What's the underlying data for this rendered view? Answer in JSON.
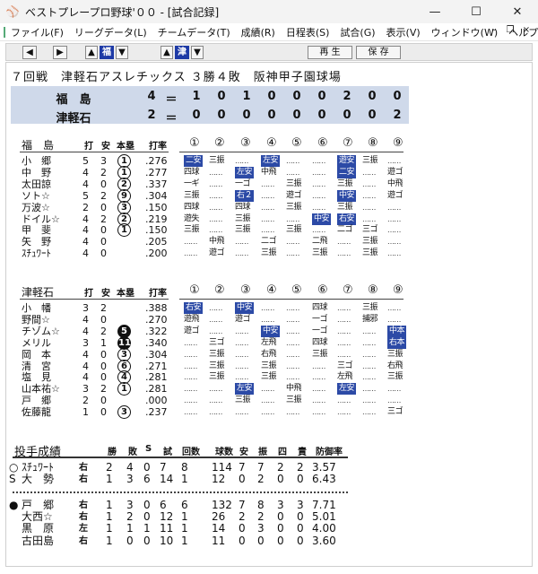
{
  "window": {
    "title": "ベストプレープロ野球'００ - [試合記録]",
    "min": "—",
    "max": "☐",
    "close": "✕"
  },
  "menu": [
    "ファイル(F)",
    "リーグデータ(L)",
    "チームデータ(T)",
    "成績(R)",
    "日程表(S)",
    "試合(G)",
    "表示(V)",
    "ウィンドウ(W)",
    "ヘルプ(H)"
  ],
  "mdi": {
    "min": "–",
    "restore": "❐",
    "close": "×"
  },
  "toolbar": {
    "prev": "◀",
    "next": "▶",
    "team1": "福",
    "team2": "津",
    "play": "再 生",
    "save": "保 存"
  },
  "game": {
    "info": "７回戦　津軽石アスレチックス ３勝４敗　阪神甲子園球場"
  },
  "score": {
    "rows": [
      {
        "team": "福　島",
        "total": "4",
        "innings": [
          "1",
          "0",
          "1",
          "0",
          "0",
          "0",
          "2",
          "0",
          "0"
        ]
      },
      {
        "team": "津軽石",
        "total": "2",
        "innings": [
          "0",
          "0",
          "0",
          "0",
          "0",
          "0",
          "0",
          "0",
          "2"
        ]
      }
    ]
  },
  "headers": {
    "ab": "打",
    "h": "安",
    "hr": "本塁",
    "avg": "打率",
    "inn": [
      "①",
      "②",
      "③",
      "④",
      "⑤",
      "⑥",
      "⑦",
      "⑧",
      "⑨"
    ]
  },
  "teamA": {
    "name": "福　島",
    "batters": [
      {
        "name": "小　郷",
        "ab": "5",
        "h": "3",
        "hr": "1",
        "avg": ".276",
        "r": [
          [
            "二安",
            1
          ],
          [
            "三振",
            0
          ],
          "",
          [
            "左安",
            1
          ],
          "",
          [
            "",
            0
          ],
          [
            "遊安",
            1
          ],
          [
            "三振",
            0
          ],
          ""
        ]
      },
      {
        "name": "中　野",
        "ab": "4",
        "h": "2",
        "hr": "1",
        "avg": ".277",
        "r": [
          [
            "四球",
            0
          ],
          "",
          [
            "左安",
            1
          ],
          [
            "中飛",
            0
          ],
          "",
          "",
          [
            "二安",
            1
          ],
          "",
          [
            "遊ゴ",
            0
          ]
        ]
      },
      {
        "name": "太田諒",
        "ab": "4",
        "h": "0",
        "hr": "2",
        "avg": ".337",
        "r": [
          [
            "一ギ",
            0
          ],
          "",
          [
            "一ゴ",
            0
          ],
          "",
          [
            "三振",
            0
          ],
          "",
          [
            "三振",
            0
          ],
          "",
          [
            "中飛",
            0
          ]
        ]
      },
      {
        "name": "ソト☆",
        "ab": "5",
        "h": "2",
        "hr": "9",
        "avg": ".304",
        "r": [
          [
            "三振",
            0
          ],
          "",
          [
            "右２",
            1
          ],
          "",
          [
            "遊ゴ",
            0
          ],
          "",
          [
            "中安",
            1
          ],
          "",
          [
            "遊ゴ",
            0
          ]
        ]
      },
      {
        "name": "万波☆",
        "ab": "2",
        "h": "0",
        "hr": "3",
        "avg": ".150",
        "r": [
          [
            "四球",
            0
          ],
          "",
          [
            "四球",
            0
          ],
          "",
          [
            "三振",
            0
          ],
          "",
          [
            "三振",
            0
          ],
          "",
          ""
        ]
      },
      {
        "name": "ドイル☆",
        "ab": "4",
        "h": "2",
        "hr": "2",
        "avg": ".219",
        "r": [
          [
            "遊失",
            0
          ],
          "",
          [
            "三振",
            0
          ],
          "",
          "",
          [
            "中安",
            1
          ],
          [
            "右安",
            1
          ],
          "",
          ""
        ]
      },
      {
        "name": "甲　斐",
        "ab": "4",
        "h": "0",
        "hr": "1",
        "avg": ".150",
        "r": [
          [
            "三振",
            0
          ],
          "",
          [
            "三振",
            0
          ],
          "",
          [
            "三振",
            0
          ],
          "",
          [
            "二ゴ",
            0
          ],
          [
            "三ゴ",
            0
          ],
          ""
        ]
      },
      {
        "name": "矢　野",
        "ab": "4",
        "h": "0",
        "hr": "",
        "avg": ".205",
        "r": [
          "",
          [
            "中飛",
            0
          ],
          "",
          [
            "二ゴ",
            0
          ],
          "",
          [
            "二飛",
            0
          ],
          "",
          [
            "三振",
            0
          ],
          ""
        ]
      },
      {
        "name": "ｽﾁｭﾜｰﾄ",
        "ab": "4",
        "h": "0",
        "hr": "",
        "avg": ".200",
        "r": [
          "",
          [
            "遊ゴ",
            0
          ],
          "",
          [
            "三振",
            0
          ],
          "",
          [
            "三振",
            0
          ],
          "",
          [
            "三振",
            0
          ],
          ""
        ]
      }
    ]
  },
  "teamB": {
    "name": "津軽石",
    "batters": [
      {
        "name": "小　幡",
        "ab": "3",
        "h": "2",
        "hr": "",
        "avg": ".388",
        "r": [
          [
            "右安",
            1
          ],
          "",
          [
            "中安",
            1
          ],
          "",
          "",
          [
            "四球",
            0
          ],
          "",
          [
            "三振",
            0
          ],
          ""
        ]
      },
      {
        "name": "野間☆",
        "ab": "4",
        "h": "0",
        "hr": "",
        "avg": ".270",
        "r": [
          [
            "遊飛",
            0
          ],
          "",
          [
            "遊ゴ",
            0
          ],
          "",
          "",
          [
            "一ゴ",
            0
          ],
          "",
          [
            "捕邪",
            0
          ],
          ""
        ]
      },
      {
        "name": "チゾム☆",
        "ab": "4",
        "h": "2",
        "hr": "5",
        "avg": ".322",
        "r": [
          [
            "遊ゴ",
            0
          ],
          "",
          "",
          [
            "中安",
            1
          ],
          "",
          [
            "一ゴ",
            0
          ],
          "",
          "",
          [
            "中本",
            1
          ]
        ]
      },
      {
        "name": "メリル",
        "ab": "3",
        "h": "1",
        "hr": "11",
        "avg": ".340",
        "r": [
          "",
          [
            "三ゴ",
            0
          ],
          "",
          [
            "左飛",
            0
          ],
          "",
          [
            "四球",
            0
          ],
          "",
          "",
          [
            "右本",
            1
          ]
        ]
      },
      {
        "name": "岡　本",
        "ab": "4",
        "h": "0",
        "hr": "3",
        "avg": ".304",
        "r": [
          "",
          [
            "三振",
            0
          ],
          "",
          [
            "右飛",
            0
          ],
          "",
          [
            "三振",
            0
          ],
          "",
          "",
          [
            "三振",
            0
          ]
        ]
      },
      {
        "name": "清　宮",
        "ab": "4",
        "h": "0",
        "hr": "6",
        "avg": ".271",
        "r": [
          "",
          [
            "三振",
            0
          ],
          "",
          [
            "三振",
            0
          ],
          "",
          "",
          [
            "三ゴ",
            0
          ],
          "",
          [
            "右飛",
            0
          ]
        ]
      },
      {
        "name": "塩　見",
        "ab": "4",
        "h": "0",
        "hr": "4",
        "avg": ".281",
        "r": [
          "",
          [
            "三振",
            0
          ],
          "",
          [
            "三振",
            0
          ],
          "",
          "",
          [
            "左飛",
            0
          ],
          "",
          [
            "三振",
            0
          ]
        ]
      },
      {
        "name": "山本祐☆",
        "ab": "3",
        "h": "2",
        "hr": "1",
        "avg": ".281",
        "r": [
          "",
          "",
          [
            "左安",
            1
          ],
          "",
          [
            "中飛",
            0
          ],
          "",
          [
            "左安",
            1
          ],
          "",
          ""
        ]
      },
      {
        "name": "戸　郷",
        "ab": "2",
        "h": "0",
        "hr": "",
        "avg": ".000",
        "r": [
          "",
          "",
          [
            "三振",
            0
          ],
          "",
          [
            "三振",
            0
          ],
          "",
          "",
          "",
          ""
        ]
      },
      {
        "name": "佐藤龍",
        "ab": "1",
        "h": "0",
        "hr": "3",
        "avg": ".237",
        "r": [
          "",
          "",
          "",
          "",
          "",
          "",
          "",
          "",
          [
            "三ゴ",
            0
          ]
        ]
      }
    ]
  },
  "pitching": {
    "title": "投手成績",
    "headers": [
      "勝",
      "敗",
      "S",
      "試",
      "回数",
      "球数",
      "安",
      "振",
      "四",
      "責",
      "防御率"
    ],
    "teamA": [
      {
        "mark": "○",
        "name": "ｽﾁｭﾜｰﾄ",
        "hand": "右",
        "v": [
          "2",
          "4",
          "0",
          "7",
          "8",
          "114",
          "7",
          "7",
          "2",
          "2",
          "3.57"
        ]
      },
      {
        "mark": "S",
        "name": "大　勢",
        "hand": "右",
        "v": [
          "1",
          "3",
          "6",
          "14",
          "1",
          "12",
          "0",
          "2",
          "0",
          "0",
          "6.43"
        ]
      }
    ],
    "teamB": [
      {
        "mark": "●",
        "name": "戸　郷",
        "hand": "右",
        "v": [
          "1",
          "3",
          "0",
          "6",
          "6",
          "132",
          "7",
          "8",
          "3",
          "3",
          "7.71"
        ]
      },
      {
        "mark": "",
        "name": "大西☆",
        "hand": "右",
        "v": [
          "1",
          "2",
          "0",
          "12",
          "1",
          "26",
          "2",
          "2",
          "0",
          "0",
          "5.01"
        ]
      },
      {
        "mark": "",
        "name": "黒　原",
        "hand": "左",
        "v": [
          "1",
          "1",
          "1",
          "11",
          "1",
          "14",
          "0",
          "3",
          "0",
          "0",
          "4.00"
        ]
      },
      {
        "mark": "",
        "name": "古田島",
        "hand": "右",
        "v": [
          "1",
          "0",
          "0",
          "10",
          "1",
          "11",
          "0",
          "0",
          "0",
          "0",
          "3.60"
        ]
      }
    ]
  }
}
